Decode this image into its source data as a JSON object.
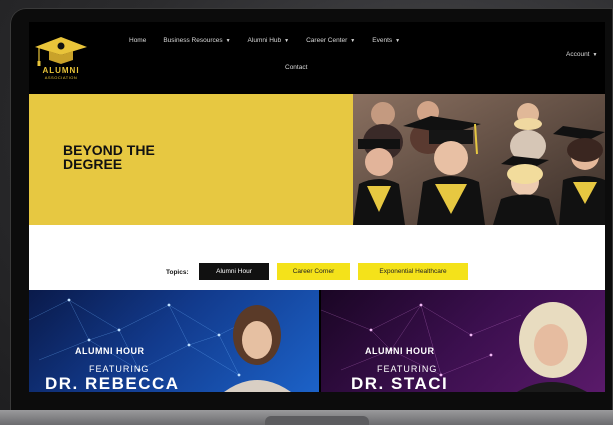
{
  "nav": {
    "logo_text": "ALUMNI",
    "logo_sub": "ASSOCIATION",
    "items": [
      {
        "label": "Home",
        "dropdown": false
      },
      {
        "label": "Business Resources",
        "dropdown": true
      },
      {
        "label": "Alumni Hub",
        "dropdown": true
      },
      {
        "label": "Career Center",
        "dropdown": true
      },
      {
        "label": "Events",
        "dropdown": true
      }
    ],
    "contact": "Contact",
    "account": "Account"
  },
  "hero": {
    "title_line1": "BEYOND THE",
    "title_line2": "DEGREE"
  },
  "topics": {
    "label": "Topics:",
    "tags": [
      "Alumni Hour",
      "Career Corner",
      "Exponential Healthcare"
    ]
  },
  "cards": [
    {
      "kicker": "ALUMNI HOUR",
      "featuring": "FEATURING",
      "name": "DR. REBECCA"
    },
    {
      "kicker": "ALUMNI HOUR",
      "featuring": "FEATURING",
      "name": "DR. STACI"
    }
  ],
  "colors": {
    "accent_yellow": "#e7c841",
    "tag_yellow": "#f4e21a",
    "nav_bg": "#000000"
  }
}
